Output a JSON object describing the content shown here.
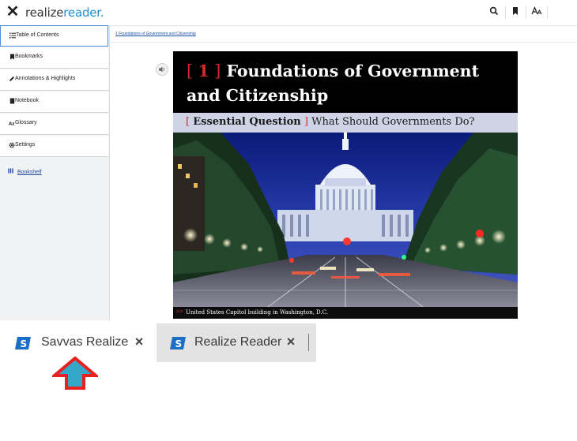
{
  "reader": {
    "close_glyph": "✕",
    "brand_prefix": "realize",
    "brand_suffix": "reader.",
    "toolbar_icons": [
      "search-icon",
      "bookmark-icon",
      "font-size-icon"
    ],
    "breadcrumb": "1 Foundations of Government and Citizenship"
  },
  "sidebar": {
    "items": [
      {
        "label": "Table of Contents",
        "icon": "list-icon",
        "active": true
      },
      {
        "label": "Bookmarks",
        "icon": "bookmark-icon",
        "active": false
      },
      {
        "label": "Annotations & Highlights",
        "icon": "pen-icon",
        "active": false
      },
      {
        "label": "Notebook",
        "icon": "notebook-icon",
        "active": false
      },
      {
        "label": "Glossary",
        "icon": "glossary-icon",
        "active": false
      },
      {
        "label": "Settings",
        "icon": "gear-icon",
        "active": false
      }
    ],
    "bookshelf_label": "Bookshelf"
  },
  "page": {
    "chapter_number": "1",
    "chapter_title": "Foundations of Government and Citizenship",
    "eq_label": "Essential Question",
    "eq_text": "What Should Governments Do?",
    "caption_marker": ">>",
    "caption": "United States Capitol building in Washington, D.C."
  },
  "browser_tabs": [
    {
      "title": "Savvas Realize",
      "active": true
    },
    {
      "title": "Realize Reader",
      "active": false
    }
  ],
  "colors": {
    "brand_blue": "#1b8fd2",
    "accent_red": "#d42a2a",
    "arrow_fill": "#35a7c9",
    "arrow_outline": "#e8211e"
  }
}
